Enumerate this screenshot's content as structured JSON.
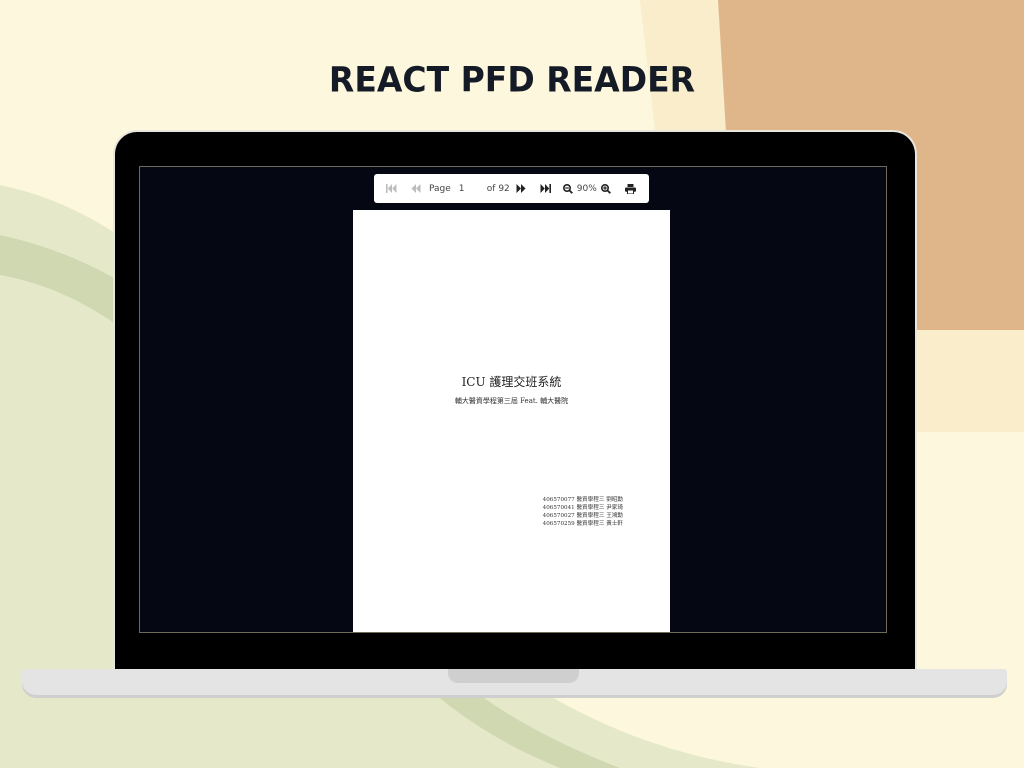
{
  "headline": "REACT PFD READER",
  "toolbar": {
    "page_label": "Page",
    "current_page": "1",
    "of_label": "of 92",
    "zoom": "90%"
  },
  "document": {
    "title": "ICU 護理交班系統",
    "subtitle": "輔大醫資學程第三屆 Feat. 輔大醫院",
    "authors": [
      "406570077 醫資學程三  劉昭勳",
      "406570041 醫資學程三  尹家琦",
      "406570027 醫資學程三  王鴻勳",
      "406570259 醫資學程三  黃士軒"
    ]
  },
  "icons": [
    "first-page-icon",
    "prev-page-icon",
    "next-page-icon",
    "last-page-icon",
    "zoom-out-icon",
    "zoom-in-icon",
    "print-icon"
  ]
}
